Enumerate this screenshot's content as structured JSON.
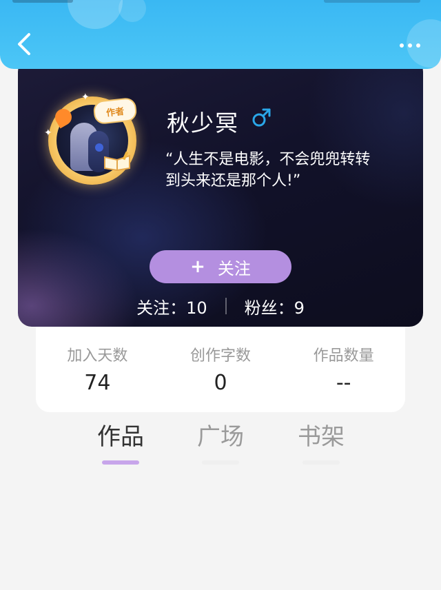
{
  "header": {
    "back_icon": "chevron-left-icon",
    "more_icon": "more-dots-icon"
  },
  "profile": {
    "author_badge": "作者",
    "username": "秋少冥",
    "gender_symbol": "♂",
    "gender_color": "#2aa7e8",
    "motto_line1": "“人生不是电影，不会兜兜转转",
    "motto_line2": "到头来还是那个人!”",
    "follow_plus": "+",
    "follow_label": "关注",
    "follow_color": "#b48fe0",
    "following": "关注：10",
    "followers": "粉丝：9"
  },
  "info": {
    "items": [
      {
        "label": "加入天数",
        "value": "74"
      },
      {
        "label": "创作字数",
        "value": "0"
      },
      {
        "label": "作品数量",
        "value": "--"
      }
    ]
  },
  "tabs": [
    {
      "label": "作品",
      "active": true
    },
    {
      "label": "广场",
      "active": false
    },
    {
      "label": "书架",
      "active": false
    }
  ],
  "colors": {
    "header_blue": "#3ab8f3",
    "tab_underline_active": "#c7a5ea"
  }
}
